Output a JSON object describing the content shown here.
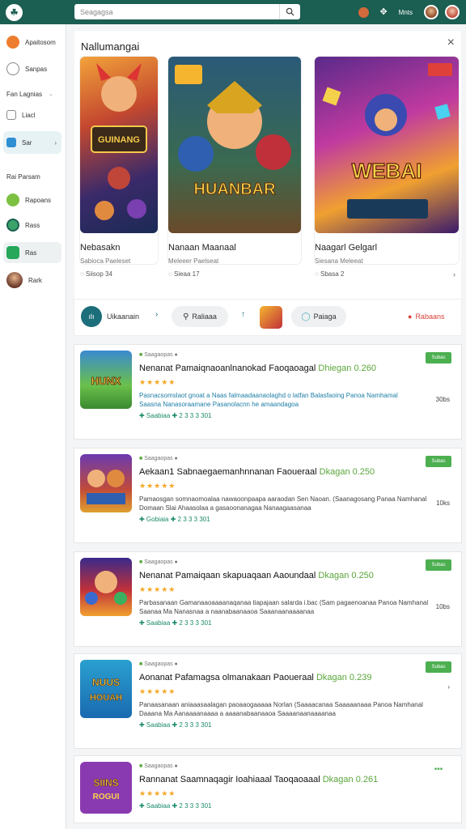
{
  "topbar": {
    "search_placeholder": "Seagagsa",
    "user_label": "Mnts"
  },
  "sidebar": {
    "top_item": "Apaitosom",
    "items1": [
      {
        "label": "Sanpas"
      },
      {
        "label": "Fan Lagnias"
      },
      {
        "label": "Liacl"
      },
      {
        "label": "Sar"
      }
    ],
    "section_label": "Rai Parsam",
    "items2": [
      {
        "label": "Rapoans"
      },
      {
        "label": "Rass"
      },
      {
        "label": "Ras"
      },
      {
        "label": "Rark"
      }
    ]
  },
  "panel": {
    "title": "Nallumangai",
    "close": "×",
    "featured": [
      {
        "name": "Nebasakn",
        "sub": "Sabioca Paeleset",
        "meta": "Siisop 34",
        "art_label": "GUINANG"
      },
      {
        "name": "Nanaan Maanaal",
        "sub": "Meleeer Paelseat",
        "meta": "Sieaa 17",
        "art_label": "HUANBAR"
      },
      {
        "name": "Naagarl Gelgarl",
        "sub": "Siesana Meleeat",
        "meta": "Sbasa 2",
        "art_label": "WEBAI"
      }
    ]
  },
  "filters": [
    {
      "label": "Uikaanain"
    },
    {
      "label": "Raliaaa"
    },
    {
      "label": "Paiaga"
    },
    {
      "label": "Rabaans"
    }
  ],
  "apps": [
    {
      "category": "Saagaopas",
      "title": "Nenanat Pamaiqnaoanlnanokad Faoqaoagal",
      "size": "Dhiegan 0.260",
      "stars": "★★★★★",
      "desc": "Pasnacsomslaot gnoat a Naas falmaadaanaolaghd o latfan Balasfaoing Panoa Namhamal",
      "desc2": "Saasna Nanasoraamane Pasanolacnn he amaandagoa",
      "meta": "✚ Saabiaa ✚ 2 3 3 3 301",
      "badge": "Subas",
      "side": "30bs"
    },
    {
      "category": "Saagaopas",
      "title": "Aekaan1 Sabnaegaemanhnnanan Faoueraal",
      "size": "Dkagan 0.250",
      "stars": "★★★★★",
      "desc": "Pamaosgan somnaomoalaa nawaoonpaapa aaraodan Sen Naoan. (Saanagosang Panaa Namhanal",
      "desc2": "Domaan Slai Ahaasolaa a gasaoonanagaa Nanaagaasanaa",
      "meta": "✚ Gobiaia ✚ 2 3 3 3 301",
      "badge": "Subas",
      "side": "10ks"
    },
    {
      "category": "Saagaopas",
      "title": "Nenanat Pamaiqaan skapuaqaan Aaoundaal",
      "size": "Dkagan 0.250",
      "stars": "★★★★★",
      "desc": "Parbasanaan Gamanaaoaaaanaqanaa tiapajaan salarda i.bac (Sam pagaenoanaa Panoa Namhanal",
      "desc2": "Saanaa Ma Nanasnaa a naanabaanaaoa Saaanaanaaaanaa",
      "meta": "✚ Saabiaa ✚ 2 3 3 3 301",
      "badge": "Subas",
      "side": "10bs"
    },
    {
      "category": "Saagaopas",
      "title": "Aonanat Pafamagsa olmanakaan Paoueraal",
      "size": "Dkagan 0.239",
      "stars": "★★★★★",
      "desc": "Panaasanaan aniaaasaalagan paoaaogaaaaa Norlan (Saaaacanaa Saaaaanaaa Panoa Namhanal",
      "desc2": "Daaana Ma Aanaaaanaaaa a aaaanabaanaaoa Saaaanaanaaaanaa",
      "meta": "✚ Saabiaa ✚ 2 3 3 3 301",
      "badge": "Subas",
      "side": ""
    },
    {
      "category": "Saagaopas",
      "title": "Rannanat Saamnaqagir Ioahiaaal Taoqaoaaal",
      "size": "Dkagan 0.261",
      "stars": "★★★★★",
      "desc": "",
      "desc2": "",
      "meta": "✚ Saabiaa ✚ 2 3 3 3 301",
      "badge": "•••",
      "side": ""
    }
  ]
}
